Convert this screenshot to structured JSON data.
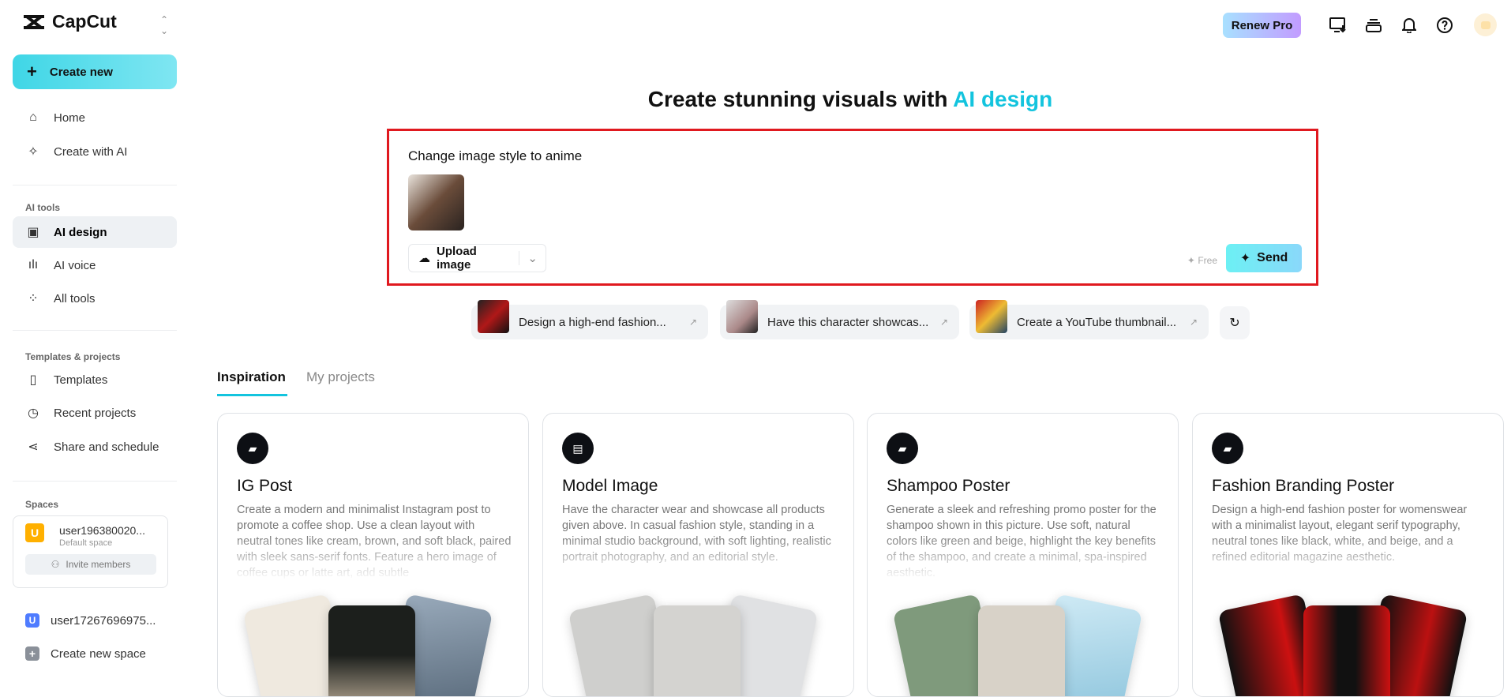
{
  "app": {
    "name": "CapCut"
  },
  "sidebar": {
    "create_new": "Create new",
    "main": [
      {
        "label": "Home",
        "icon": "home-icon"
      },
      {
        "label": "Create with AI",
        "icon": "sparkle-icon"
      }
    ],
    "ai_tools_title": "AI tools",
    "ai_tools": [
      {
        "label": "AI design",
        "active": true
      },
      {
        "label": "AI voice"
      },
      {
        "label": "All tools"
      }
    ],
    "templates_title": "Templates & projects",
    "templates": [
      {
        "label": "Templates"
      },
      {
        "label": "Recent projects"
      },
      {
        "label": "Share and schedule"
      }
    ],
    "spaces_title": "Spaces",
    "spaces": [
      {
        "initial": "U",
        "name": "user196380020...",
        "sub": "Default space",
        "color": "#ffb000"
      },
      {
        "initial": "U",
        "name": "user17267696975...",
        "color": "#4f7cff"
      }
    ],
    "invite": "Invite members",
    "create_space": "Create new space"
  },
  "header": {
    "renew": "Renew Pro"
  },
  "main": {
    "title_prefix": "Create stunning visuals with ",
    "title_highlight": "AI design",
    "prompt": {
      "text": "Change image style to anime",
      "upload": "Upload image",
      "free": "Free",
      "send": "Send"
    },
    "suggestions": [
      "Design a high-end fashion...",
      "Have this character showcas...",
      "Create a YouTube thumbnail..."
    ],
    "tabs": [
      "Inspiration",
      "My projects"
    ],
    "cards": [
      {
        "title": "IG Post",
        "desc": "Create a modern and minimalist Instagram post to promote a coffee shop. Use a clean layout with neutral tones like cream, brown, and soft black, paired with sleek sans-serif fonts. Feature a hero image of coffee cups or latte art, add subtle"
      },
      {
        "title": "Model Image",
        "desc": "Have the character wear and showcase all products given above. In casual fashion style, standing in a minimal studio background, with soft lighting, realistic portrait photography, and an editorial style."
      },
      {
        "title": "Shampoo Poster",
        "desc": "Generate a sleek and refreshing promo poster for the shampoo shown in this picture. Use soft, natural colors like green and beige, highlight the key benefits of the shampoo, and create a minimal, spa-inspired aesthetic."
      },
      {
        "title": "Fashion Branding Poster",
        "desc": "Design a high-end fashion poster for womenswear with a minimalist layout, elegant serif typography, neutral tones like black, white, and beige, and a refined editorial magazine aesthetic."
      }
    ]
  }
}
